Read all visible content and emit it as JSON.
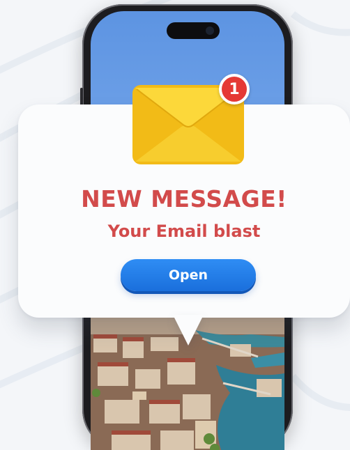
{
  "notification": {
    "badge_count": "1",
    "title": "NEW MESSAGE!",
    "subtitle": "Your Email blast",
    "open_label": "Open"
  },
  "icons": {
    "envelope": "envelope-icon",
    "badge": "notification-badge"
  },
  "colors": {
    "title_red": "#d24b4b",
    "button_blue": "#1f78e6",
    "badge_red": "#e53935",
    "envelope_yellow": "#f7c81f"
  }
}
